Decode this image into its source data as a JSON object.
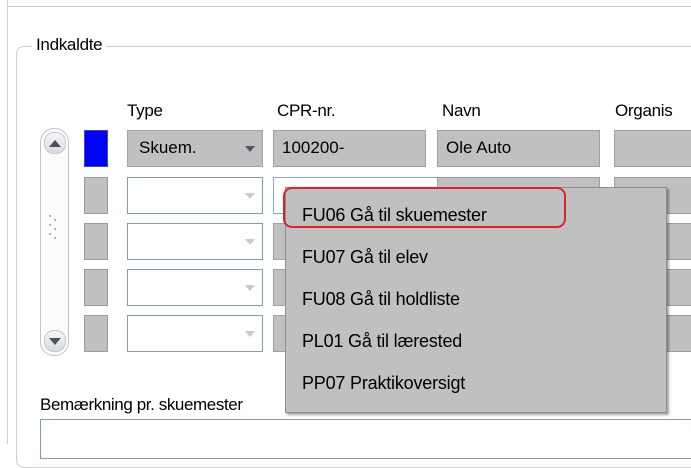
{
  "group": {
    "title": "Indkaldte"
  },
  "columns": {
    "type": "Type",
    "cpr": "CPR-nr.",
    "name": "Navn",
    "org": "Organis"
  },
  "rows": [
    {
      "type": "Skuem.",
      "cpr": "100200-",
      "name": "Ole Auto"
    },
    {
      "type": "",
      "cpr": "",
      "name": ""
    },
    {
      "type": "",
      "cpr": "",
      "name": ""
    },
    {
      "type": "",
      "cpr": "",
      "name": ""
    },
    {
      "type": "",
      "cpr": "",
      "name": ""
    }
  ],
  "context_menu": {
    "items": [
      {
        "label": "FU06 Gå til skuemester"
      },
      {
        "label": "FU07 Gå til elev"
      },
      {
        "label": "FU08 Gå til holdliste"
      },
      {
        "label": "PL01 Gå til lærested"
      },
      {
        "label": "PP07 Praktikoversigt"
      }
    ]
  },
  "remark": {
    "label": "Bemærkning pr. skuemester"
  },
  "colors": {
    "active_indicator": "#0000ff",
    "highlight": "#e0202a",
    "cell_gray": "#c0c0c0"
  }
}
